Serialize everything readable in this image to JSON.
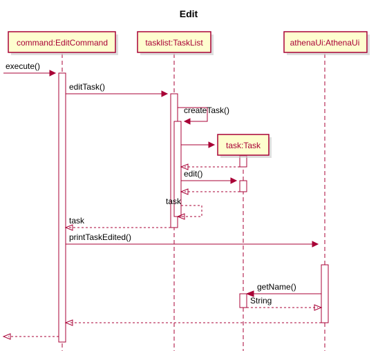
{
  "title": "Edit",
  "participants": {
    "p1": "command:EditCommand",
    "p2": "tasklist:TaskList",
    "p3": "task:Task",
    "p4": "athenaUi:AthenaUi"
  },
  "messages": {
    "m1": "execute()",
    "m2": "editTask()",
    "m3": "createTask()",
    "m4": "edit()",
    "m5": "task",
    "m6": "task",
    "m7": "printTaskEdited()",
    "m8": "getName()",
    "m9": "String"
  },
  "chart_data": {
    "type": "sequence-diagram",
    "title": "Edit",
    "participants": [
      {
        "id": "command",
        "label": "command:EditCommand"
      },
      {
        "id": "tasklist",
        "label": "tasklist:TaskList"
      },
      {
        "id": "task",
        "label": "task:Task",
        "created_during": true
      },
      {
        "id": "athenaUi",
        "label": "athenaUi:AthenaUi"
      }
    ],
    "messages": [
      {
        "from": "external",
        "to": "command",
        "label": "execute()",
        "type": "sync"
      },
      {
        "from": "command",
        "to": "tasklist",
        "label": "editTask()",
        "type": "sync"
      },
      {
        "from": "tasklist",
        "to": "tasklist",
        "label": "createTask()",
        "type": "self"
      },
      {
        "from": "tasklist",
        "to": "task",
        "label": "",
        "type": "create"
      },
      {
        "from": "task",
        "to": "tasklist",
        "label": "",
        "type": "return"
      },
      {
        "from": "tasklist",
        "to": "task",
        "label": "edit()",
        "type": "sync"
      },
      {
        "from": "task",
        "to": "tasklist",
        "label": "",
        "type": "return"
      },
      {
        "from": "tasklist",
        "to": "tasklist",
        "label": "task",
        "type": "self-return"
      },
      {
        "from": "tasklist",
        "to": "command",
        "label": "task",
        "type": "return"
      },
      {
        "from": "command",
        "to": "athenaUi",
        "label": "printTaskEdited()",
        "type": "sync"
      },
      {
        "from": "athenaUi",
        "to": "task",
        "label": "getName()",
        "type": "sync"
      },
      {
        "from": "task",
        "to": "athenaUi",
        "label": "String",
        "type": "return"
      },
      {
        "from": "athenaUi",
        "to": "command",
        "label": "",
        "type": "return"
      },
      {
        "from": "command",
        "to": "external",
        "label": "",
        "type": "return"
      }
    ]
  }
}
